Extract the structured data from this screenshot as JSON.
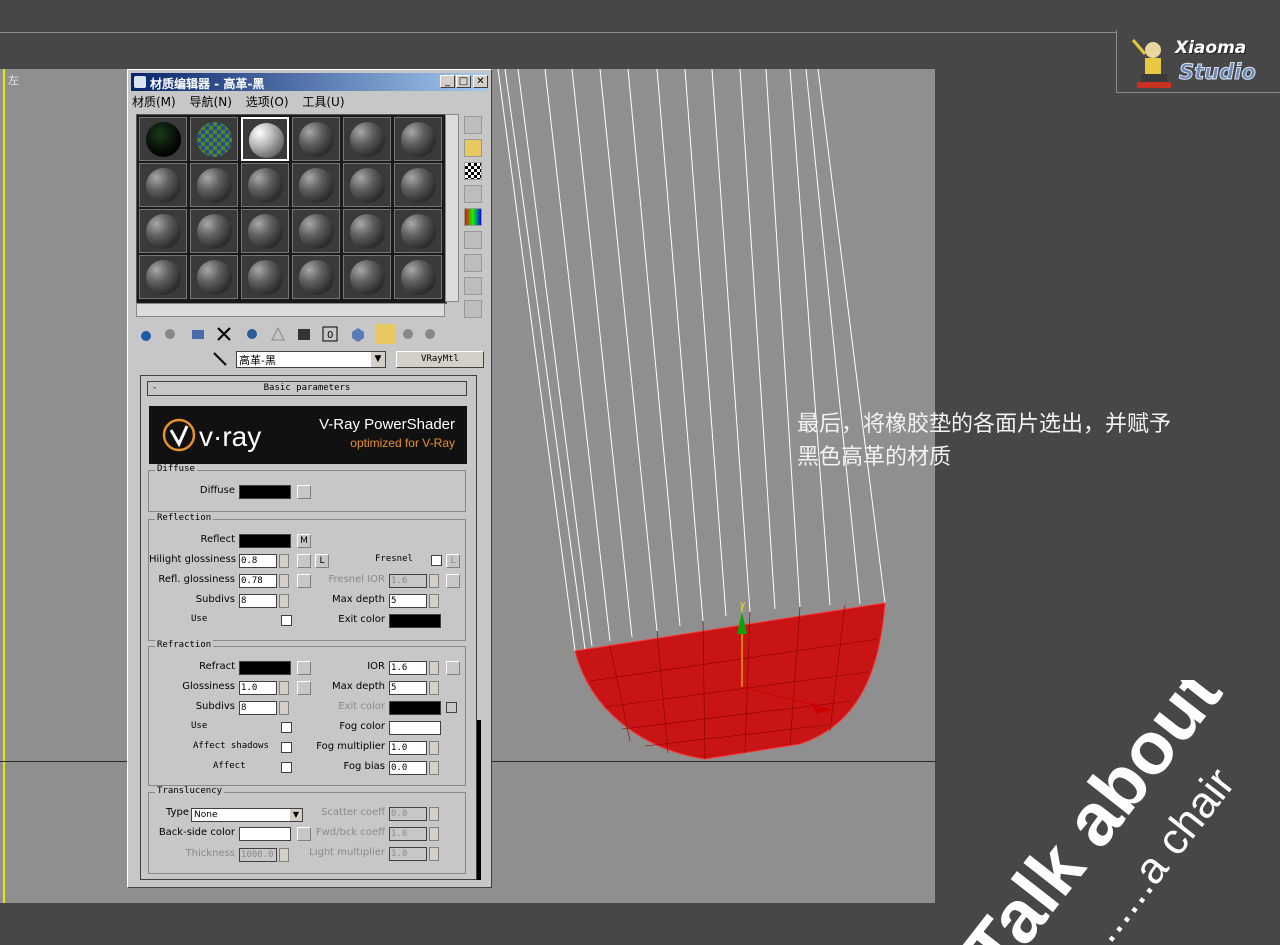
{
  "viewport": {
    "label": "左"
  },
  "caption": {
    "line1": "最后，将橡胶垫的各面片选出，并赋予",
    "line2": "黑色高革的材质"
  },
  "logo": {
    "line1": "Xiaoma",
    "line2": "Studio"
  },
  "watermark": {
    "line1": "Talk about",
    "line2": "......a chair"
  },
  "window": {
    "title": "材质编辑器 - 高革-黑",
    "menu": [
      "材质(M)",
      "导航(N)",
      "选项(O)",
      "工具(U)"
    ],
    "material_name": "高革-黑",
    "material_type": "VRayMtl"
  },
  "params": {
    "rollout_title": "Basic parameters",
    "banner_title": "V-Ray PowerShader",
    "banner_sub": "optimized for V-Ray",
    "banner_logo": "v·ray",
    "diffuse": {
      "title": "Diffuse",
      "label": "Diffuse",
      "color": "#000000"
    },
    "reflection": {
      "title": "Reflection",
      "reflect": "Reflect",
      "reflect_color": "#000000",
      "map_m": "M",
      "hilight": "Hilight glossiness",
      "hilight_val": "0.8",
      "lock_l": "L",
      "fresnel": "Fresnel",
      "fresnel_l": "L",
      "refl_gloss": "Refl. glossiness",
      "refl_gloss_val": "0.78",
      "fresnel_ior": "Fresnel IOR",
      "fresnel_ior_val": "1.6",
      "subdivs": "Subdivs",
      "subdivs_val": "8",
      "max_depth": "Max depth",
      "max_depth_val": "5",
      "use": "Use",
      "exit_color": "Exit color",
      "exit_color_val": "#000000"
    },
    "refraction": {
      "title": "Refraction",
      "refract": "Refract",
      "refract_color": "#000000",
      "ior": "IOR",
      "ior_val": "1.6",
      "glossiness": "Glossiness",
      "glossiness_val": "1.0",
      "max_depth": "Max depth",
      "max_depth_val": "5",
      "subdivs": "Subdivs",
      "subdivs_val": "8",
      "exit_color": "Exit color",
      "exit_color_val": "#000000",
      "use": "Use",
      "fog_color": "Fog color",
      "fog_color_val": "#ffffff",
      "affect_shadows": "Affect shadows",
      "fog_multiplier": "Fog multiplier",
      "fog_multiplier_val": "1.0",
      "affect": "Affect",
      "fog_bias": "Fog bias",
      "fog_bias_val": "0.0"
    },
    "translucency": {
      "title": "Translucency",
      "type": "Type",
      "type_val": "None",
      "scatter": "Scatter coeff",
      "scatter_val": "0.0",
      "backside": "Back-side color",
      "backside_color": "#ffffff",
      "fwd_bck": "Fwd/bck coeff",
      "fwd_bck_val": "1.0",
      "thickness": "Thickness",
      "thickness_val": "1000.0",
      "light_mult": "Light multiplier",
      "light_mult_val": "1.0"
    }
  }
}
